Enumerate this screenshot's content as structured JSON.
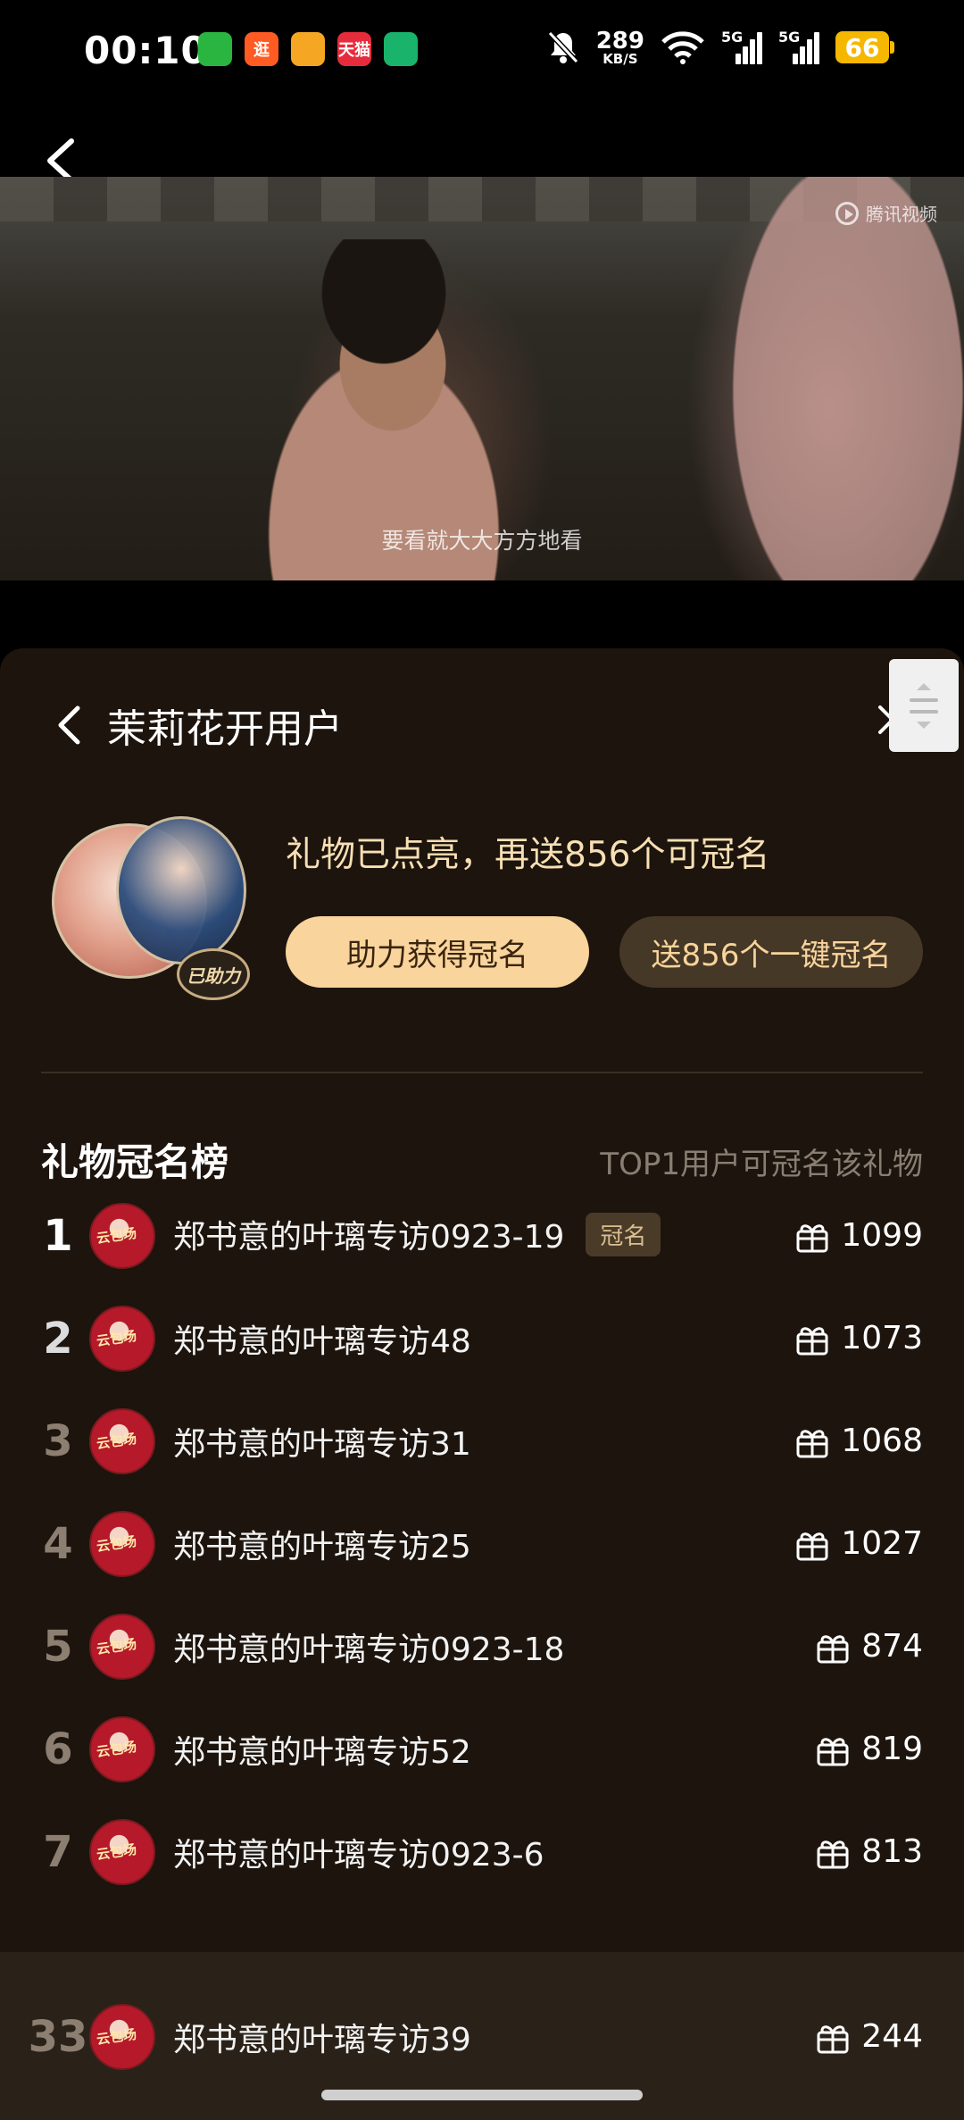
{
  "status_bar": {
    "time": "00:10",
    "apps": [
      {
        "icon": "wechat-icon",
        "color": "#2ab540",
        "label": ""
      },
      {
        "icon": "taobao-icon",
        "color": "#ff5b22",
        "label": "逛"
      },
      {
        "icon": "weibo-icon",
        "color": "#f5a623",
        "label": ""
      },
      {
        "icon": "tmall-icon",
        "color": "#e62c3c",
        "label": "天猫"
      },
      {
        "icon": "battery-saver-icon",
        "color": "#19b36b",
        "label": ""
      }
    ],
    "net_speed": "289",
    "net_unit": "KB/S",
    "sig1": "5G",
    "sig2": "5G",
    "battery": "66"
  },
  "video": {
    "watermark": "腾讯视频",
    "subtitle": "要看就大大方方地看"
  },
  "panel": {
    "title": "茉莉花开用户",
    "avatar_badge": "已助力",
    "lit_text": "礼物已点亮，再送856个可冠名",
    "help_button": "助力获得冠名",
    "send_button": "送856个一键冠名",
    "rank_title": "礼物冠名榜",
    "rank_subtitle": "TOP1用户可冠名该礼物"
  },
  "ranking": [
    {
      "rank": "1",
      "name": "郑书意的叶璃专访0923-19",
      "tag": "冠名",
      "score": "1099",
      "color": "#ffffff"
    },
    {
      "rank": "2",
      "name": "郑书意的叶璃专访48",
      "tag": "",
      "score": "1073",
      "color": "#dcdcdc"
    },
    {
      "rank": "3",
      "name": "郑书意的叶璃专访31",
      "tag": "",
      "score": "1068",
      "color": "#8c7f72"
    },
    {
      "rank": "4",
      "name": "郑书意的叶璃专访25",
      "tag": "",
      "score": "1027",
      "color": "#8c7f72"
    },
    {
      "rank": "5",
      "name": "郑书意的叶璃专访0923-18",
      "tag": "",
      "score": "874",
      "color": "#8c7f72"
    },
    {
      "rank": "6",
      "name": "郑书意的叶璃专访52",
      "tag": "",
      "score": "819",
      "color": "#8c7f72"
    },
    {
      "rank": "7",
      "name": "郑书意的叶璃专访0923-6",
      "tag": "",
      "score": "813",
      "color": "#8c7f72"
    }
  ],
  "my_rank": {
    "rank": "33",
    "name": "郑书意的叶璃专访39",
    "score": "244",
    "color": "#8c7f72"
  },
  "avatar_text": "云包场"
}
